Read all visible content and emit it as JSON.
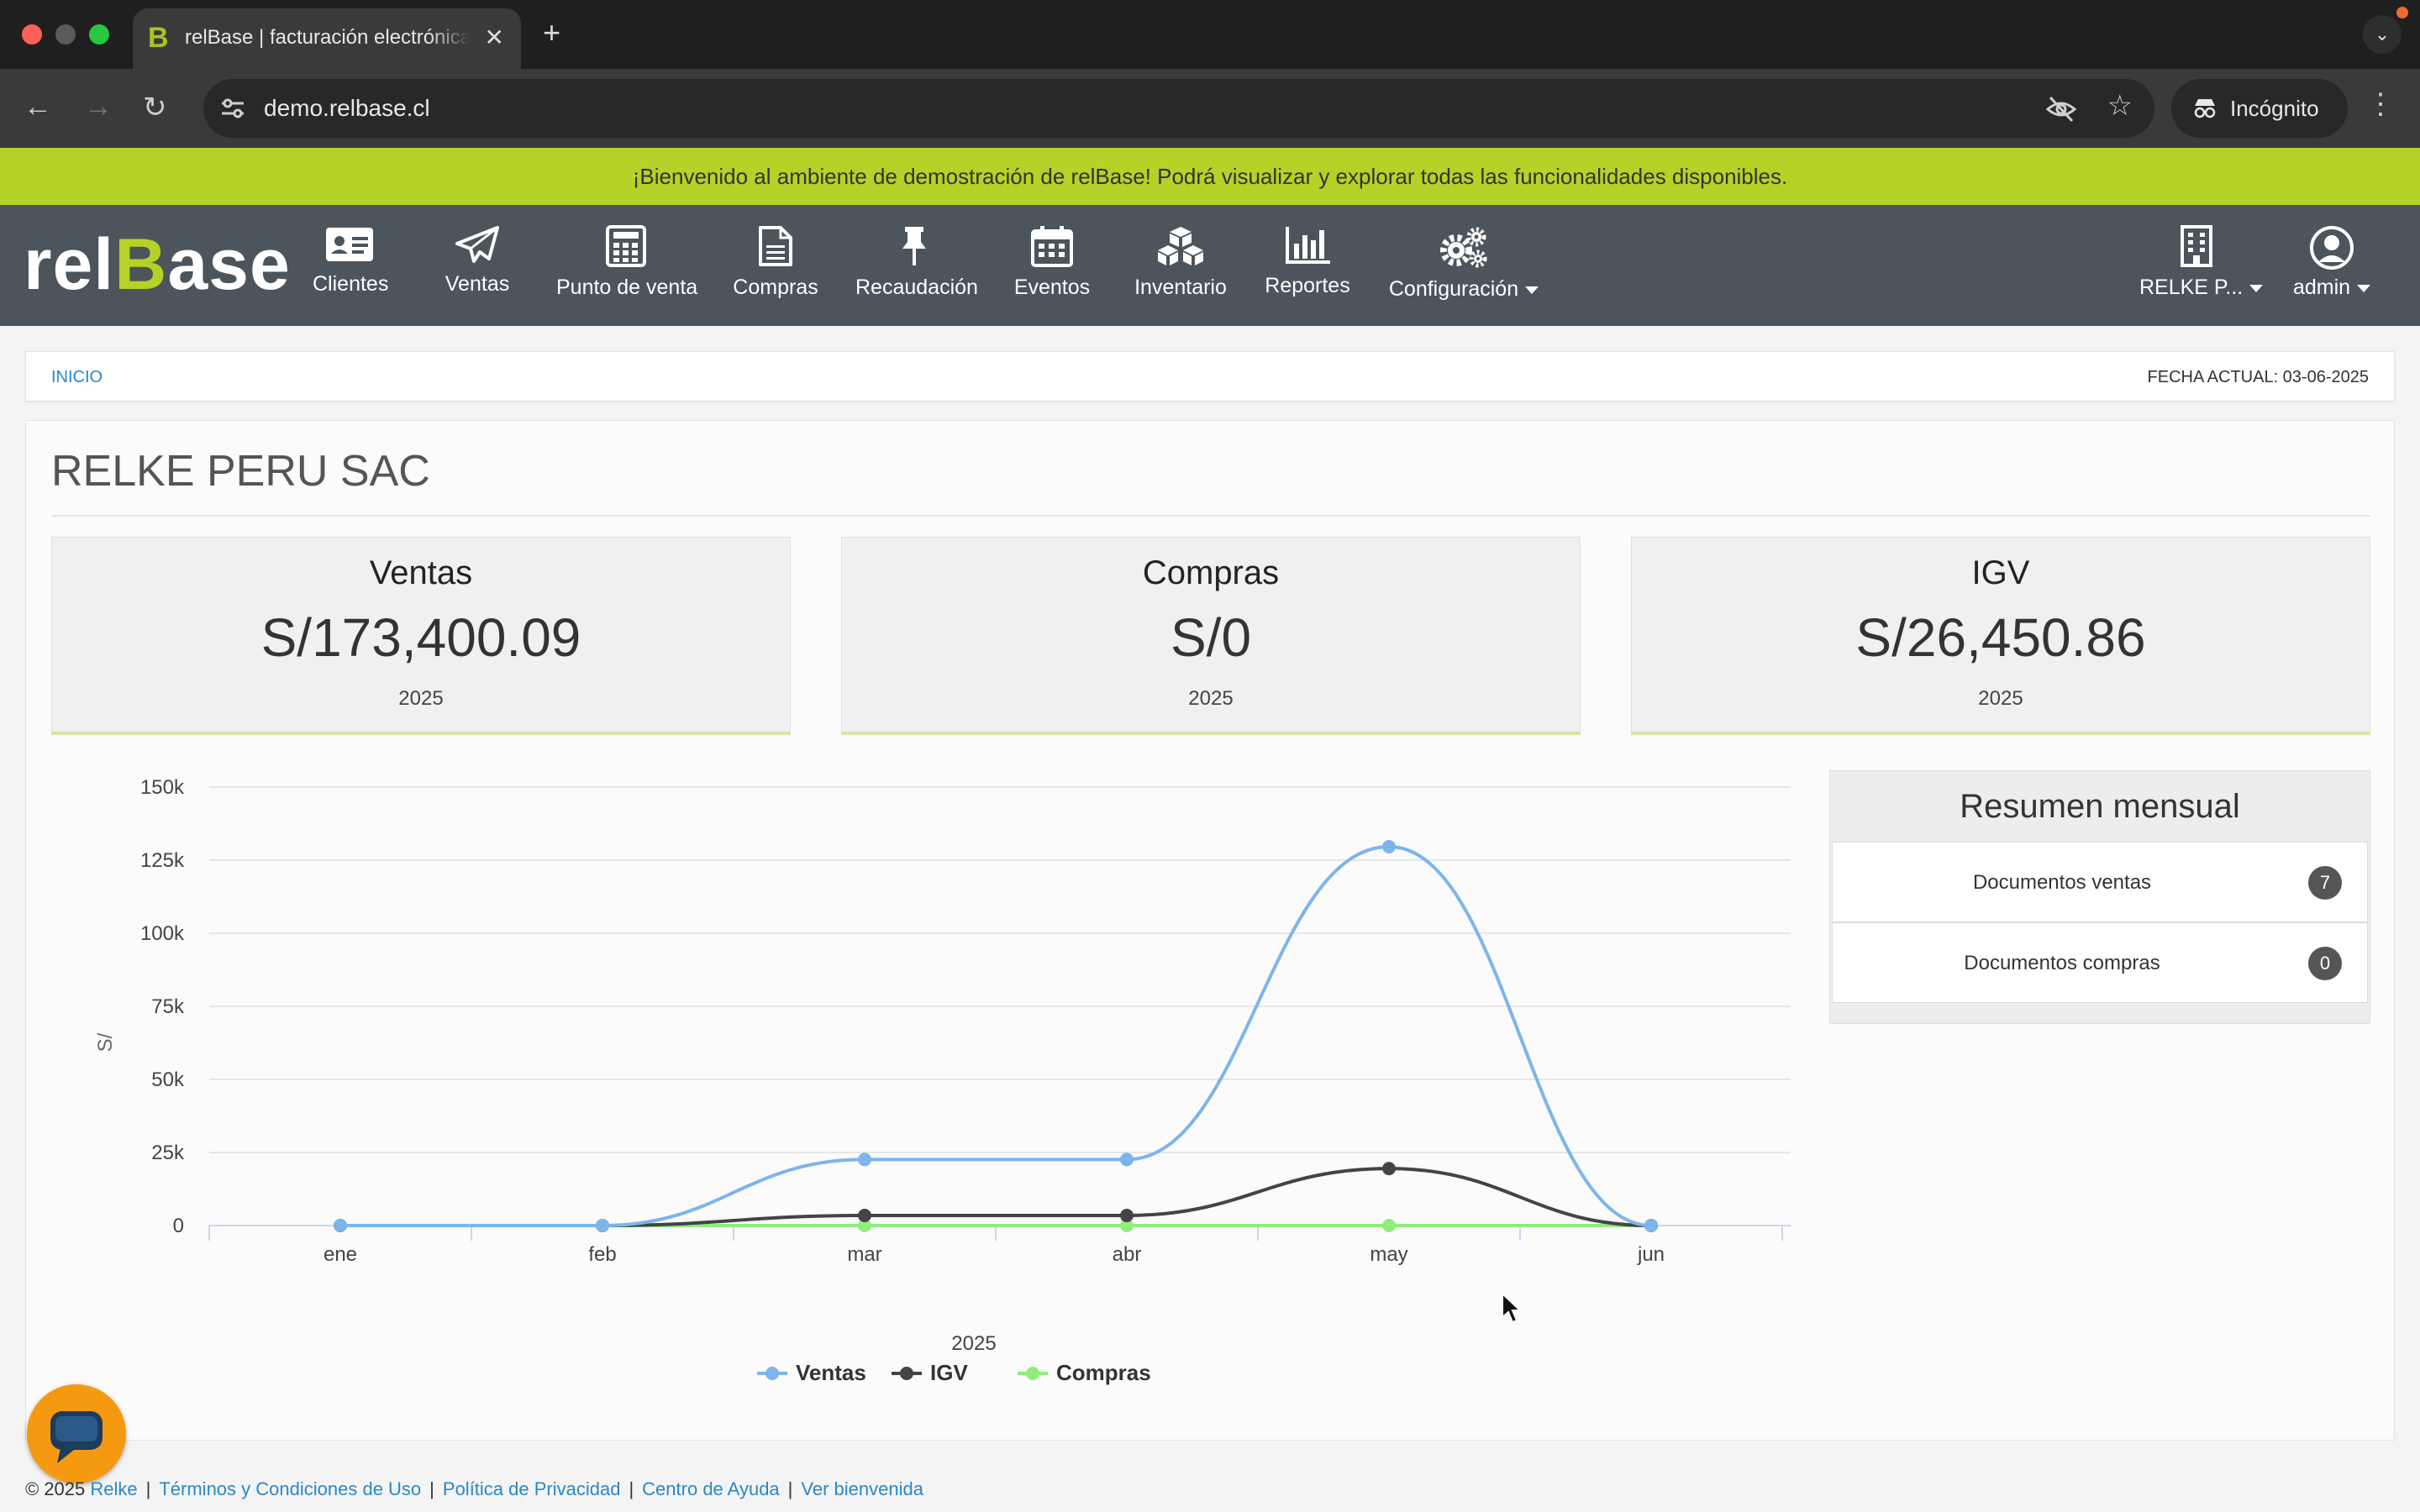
{
  "browser": {
    "tab_title": "relBase | facturación electrónica",
    "tab_favicon": "B",
    "url": "demo.relbase.cl",
    "incognito_label": "Incógnito",
    "new_tab_symbol": "+",
    "close_symbol": "✕"
  },
  "banner": {
    "text": "¡Bienvenido al ambiente de demostración de relBase! Podrá visualizar y explorar todas las funcionalidades disponibles."
  },
  "nav": {
    "logo_pre": "rel",
    "logo_b": "B",
    "logo_post": "ase",
    "items": [
      {
        "label": "Clientes",
        "icon": "id-card-icon"
      },
      {
        "label": "Ventas",
        "icon": "paper-plane-icon"
      },
      {
        "label": "Punto de venta",
        "icon": "calculator-icon"
      },
      {
        "label": "Compras",
        "icon": "document-icon"
      },
      {
        "label": "Recaudación",
        "icon": "pushpin-icon"
      },
      {
        "label": "Eventos",
        "icon": "calendar-icon"
      },
      {
        "label": "Inventario",
        "icon": "cubes-icon"
      },
      {
        "label": "Reportes",
        "icon": "bar-chart-icon"
      },
      {
        "label": "Configuración",
        "icon": "gears-icon"
      }
    ],
    "company_menu": "RELKE P...",
    "user_menu": "admin"
  },
  "breadcrumb": {
    "home": "INICIO",
    "date": "FECHA ACTUAL: 03-06-2025"
  },
  "page": {
    "company": "RELKE PERU SAC"
  },
  "stats": [
    {
      "title": "Ventas",
      "value": "S/173,400.09",
      "year": "2025"
    },
    {
      "title": "Compras",
      "value": "S/0",
      "year": "2025"
    },
    {
      "title": "IGV",
      "value": "S/26,450.86",
      "year": "2025"
    }
  ],
  "chart_data": {
    "type": "line",
    "categories": [
      "ene",
      "feb",
      "mar",
      "abr",
      "may",
      "jun"
    ],
    "xlabel": "2025",
    "ylabel": "S/",
    "ylim": [
      0,
      150000
    ],
    "yticks": [
      "0",
      "25k",
      "50k",
      "75k",
      "100k",
      "125k",
      "150k"
    ],
    "grid": true,
    "legend": "bottom-center",
    "series": [
      {
        "name": "Ventas",
        "color": "#7cb5ec",
        "values": [
          0,
          0,
          22600,
          22600,
          129600,
          0
        ]
      },
      {
        "name": "IGV",
        "color": "#434348",
        "values": [
          0,
          0,
          3450,
          3450,
          19500,
          0
        ]
      },
      {
        "name": "Compras",
        "color": "#90ed7d",
        "values": [
          0,
          0,
          0,
          0,
          0,
          0
        ]
      }
    ]
  },
  "resumen": {
    "title": "Resumen mensual",
    "rows": [
      {
        "label": "Documentos ventas",
        "count": "7"
      },
      {
        "label": "Documentos compras",
        "count": "0"
      }
    ]
  },
  "footer": {
    "copyright": "© 2025",
    "company_link": "Relke",
    "links": [
      "Términos y Condiciones de Uso",
      "Política de Privacidad",
      "Centro de Ayuda",
      "Ver bienvenida"
    ]
  },
  "colors": {
    "banner": "#b4d227",
    "nav": "#4b555b",
    "accent": "#b4d227",
    "chat": "#f59a10"
  }
}
